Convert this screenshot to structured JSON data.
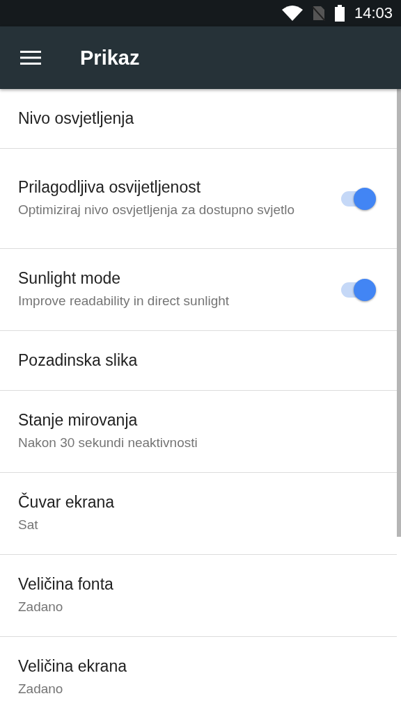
{
  "status_bar": {
    "time": "14:03"
  },
  "app_bar": {
    "title": "Prikaz"
  },
  "settings": [
    {
      "kind": "plain",
      "title": "Nivo osvjetljenja"
    },
    {
      "kind": "switch",
      "title": "Prilagodljiva osvijetljenost",
      "summary": "Optimiziraj nivo osvjetljenja za dostupno svjetlo",
      "on": true
    },
    {
      "kind": "switch",
      "title": "Sunlight mode",
      "summary": "Improve readability in direct sunlight",
      "on": true
    },
    {
      "kind": "plain",
      "title": "Pozadinska slika"
    },
    {
      "kind": "plain",
      "title": "Stanje mirovanja",
      "summary": "Nakon 30 sekundi neaktivnosti"
    },
    {
      "kind": "plain",
      "title": "Čuvar ekrana",
      "summary": "Sat"
    },
    {
      "kind": "plain",
      "title": "Veličina fonta",
      "summary": "Zadano"
    },
    {
      "kind": "plain",
      "title": "Veličina ekrana",
      "summary": "Zadano"
    }
  ]
}
